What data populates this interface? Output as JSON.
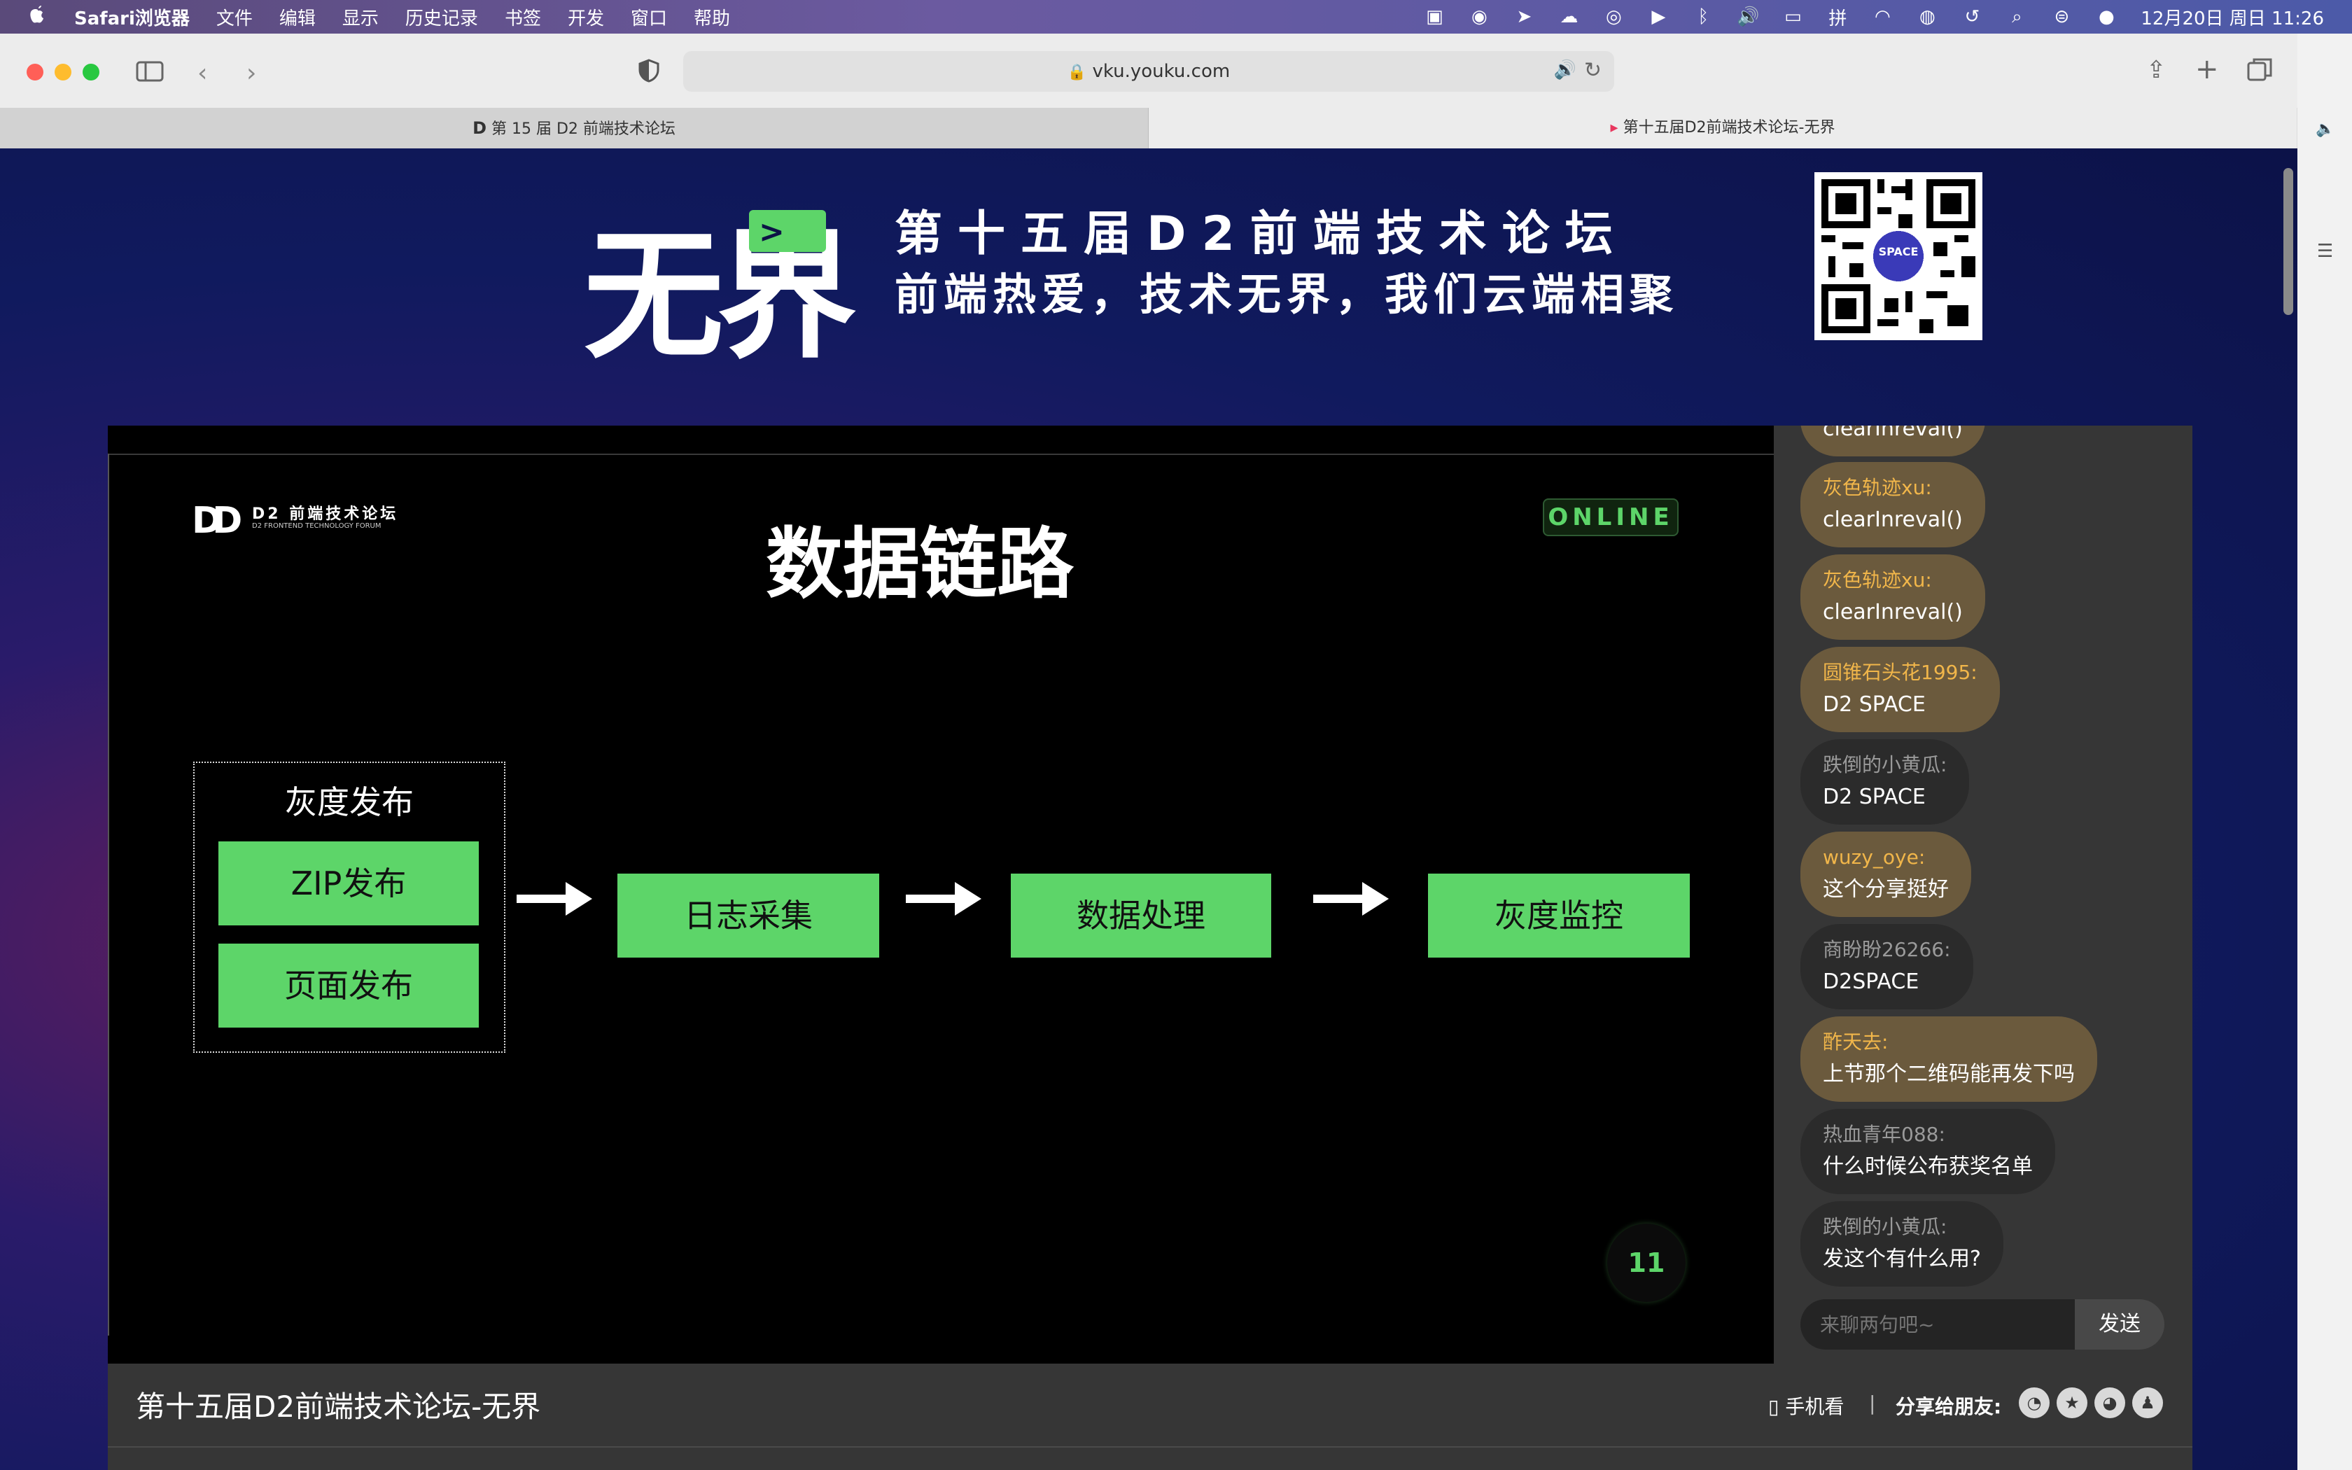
{
  "menubar": {
    "apple": "",
    "items": [
      "Safari浏览器",
      "文件",
      "编辑",
      "显示",
      "历史记录",
      "书签",
      "开发",
      "窗口",
      "帮助"
    ],
    "clock": "12月20日 周日 11:26"
  },
  "toolbar": {
    "url": "vku.youku.com"
  },
  "tabs": [
    "第 15 届 D2 前端技术论坛",
    "第十五届D2前端技术论坛-无界"
  ],
  "banner": {
    "brand": "无界",
    "line1": "第十五届D2前端技术论坛",
    "line2": "前端热爱，技术无界，我们云端相聚",
    "qr_badge": "SPACE"
  },
  "slide": {
    "logo_title": "D2 前端技术论坛",
    "logo_sub": "D2 FRONTEND TECHNOLOGY FORUM",
    "title": "数据链路",
    "online": "ONLINE",
    "group_title": "灰度发布",
    "group_items": [
      "ZIP发布",
      "页面发布"
    ],
    "flow": [
      "日志采集",
      "数据处理",
      "灰度监控"
    ],
    "page_num": "11"
  },
  "chat": {
    "partial_top": "clearInreval()",
    "messages": [
      {
        "user": "灰色轨迹xu:",
        "text": "clearInreval()",
        "style": "gold"
      },
      {
        "user": "灰色轨迹xu:",
        "text": "clearInreval()",
        "style": "gold"
      },
      {
        "user": "圆锥石头花1995:",
        "text": "D2 SPACE",
        "style": "gold"
      },
      {
        "user": "跌倒的小黄瓜:",
        "text": "D2 SPACE",
        "style": "dark"
      },
      {
        "user": "wuzy_oye:",
        "text": "这个分享挺好",
        "style": "gold"
      },
      {
        "user": "商盼盼26266:",
        "text": "D2SPACE",
        "style": "dark"
      },
      {
        "user": "酢天去:",
        "text": "上节那个二维码能再发下吗",
        "style": "gold"
      },
      {
        "user": "热血青年088:",
        "text": "什么时候公布获奖名单",
        "style": "dark"
      },
      {
        "user": "跌倒的小黄瓜:",
        "text": "发这个有什么用?",
        "style": "dark"
      }
    ],
    "input_placeholder": "来聊两句吧~",
    "send_label": "发送"
  },
  "info": {
    "title": "第十五届D2前端技术论坛-无界",
    "mobile": "手机看",
    "divider": "|",
    "share_label": "分享给朋友:"
  },
  "colors": {
    "accent_green": "#5dd569",
    "gold_bubble": "#6b5a3d",
    "gold_name": "#f1b64a"
  }
}
